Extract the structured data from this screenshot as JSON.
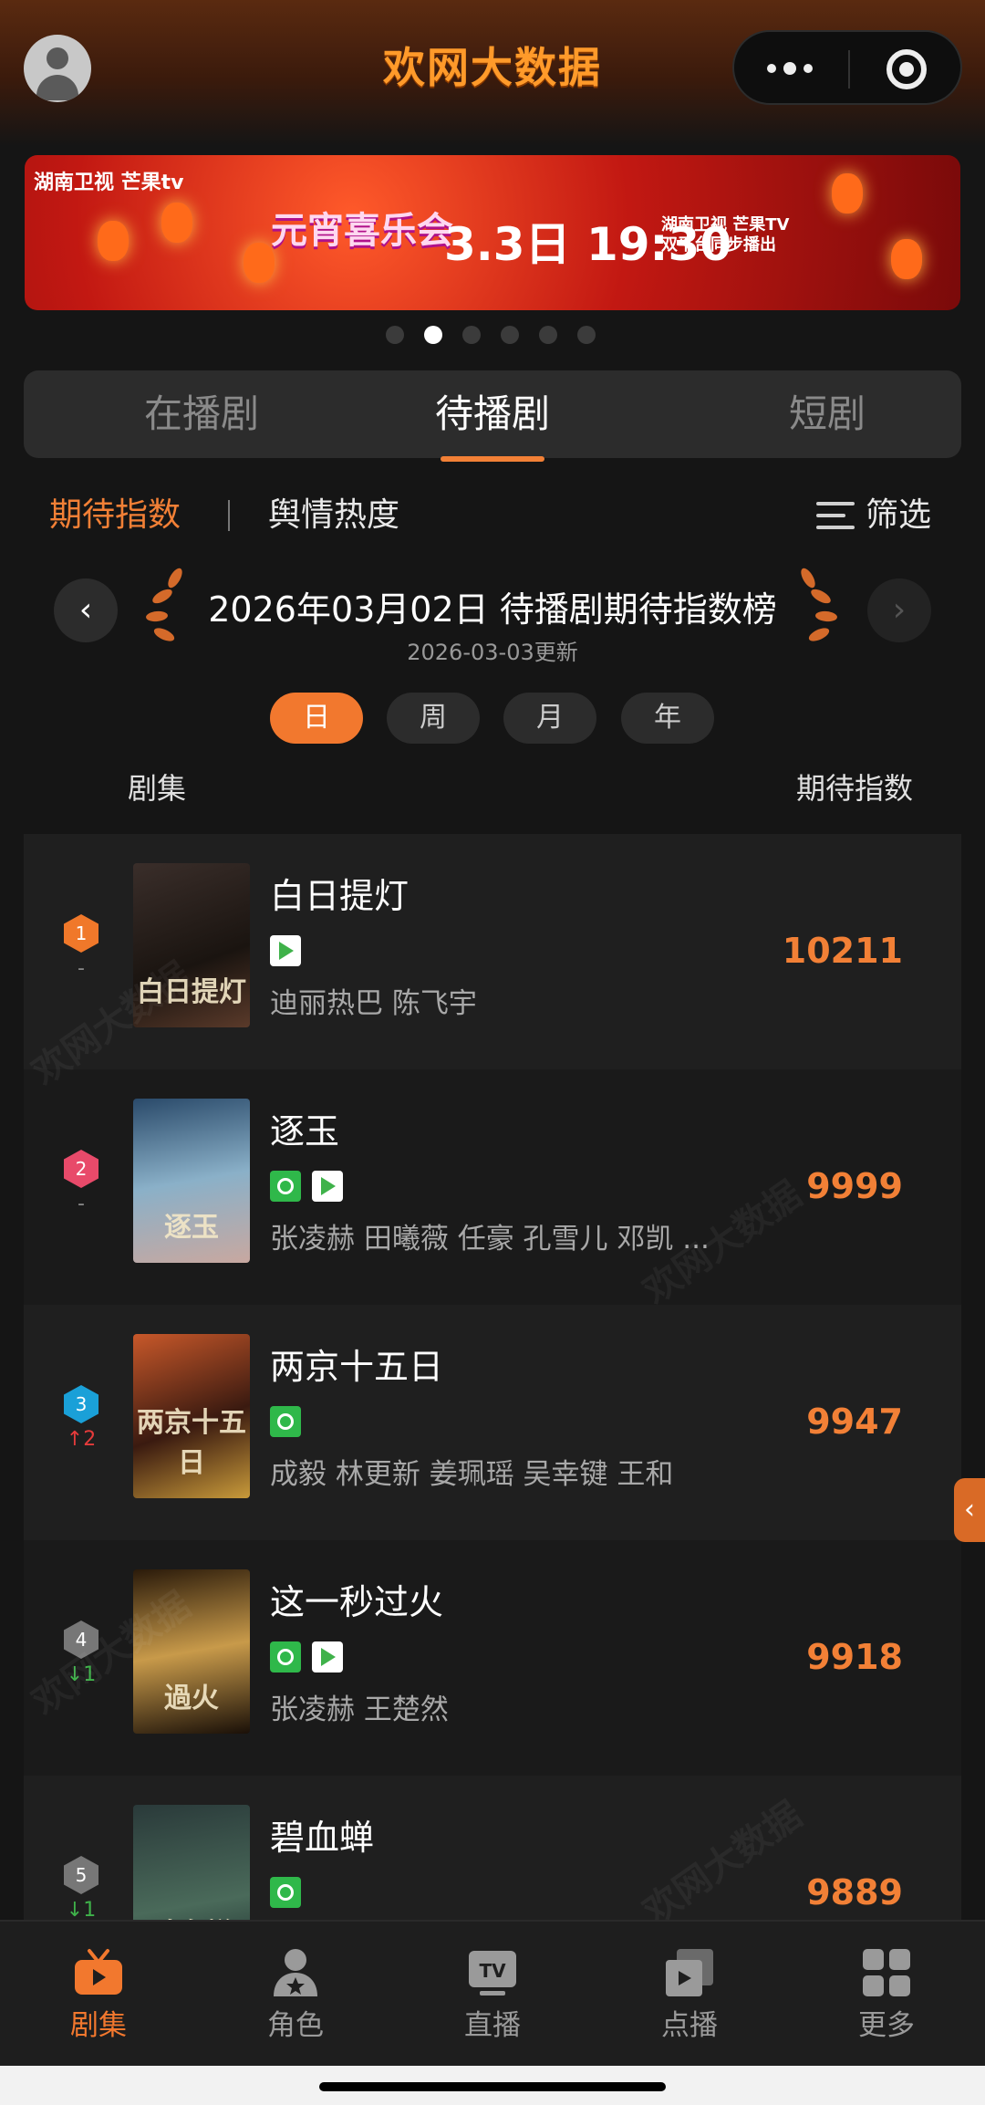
{
  "header": {
    "logo_text": "欢网大数据"
  },
  "banner": {
    "channels": "湖南卫视 芒果tv",
    "show": "元宵喜乐会",
    "date": "3.3日 19:30",
    "sub_line1": "湖南卫视 芒果TV",
    "sub_line2": "双平台同步播出"
  },
  "carousel": {
    "count": 6,
    "active_index": 1
  },
  "tabs": [
    {
      "label": "在播剧",
      "active": false
    },
    {
      "label": "待播剧",
      "active": true
    },
    {
      "label": "短剧",
      "active": false
    }
  ],
  "subtabs": {
    "expect": "期待指数",
    "sentiment": "舆情热度",
    "filter": "筛选"
  },
  "ranking": {
    "title": "2026年03月02日 待播剧期待指数榜",
    "updated": "2026-03-03更新",
    "prev_icon": "chevron-left-icon",
    "next_icon": "chevron-right-icon"
  },
  "periods": [
    {
      "label": "日",
      "active": true
    },
    {
      "label": "周",
      "active": false
    },
    {
      "label": "月",
      "active": false
    },
    {
      "label": "年",
      "active": false
    }
  ],
  "columns": {
    "left": "剧集",
    "right": "期待指数"
  },
  "shows": [
    {
      "rank": "1",
      "rank_color": "#f0782a",
      "trend": "-",
      "trend_dir": "none",
      "title": "白日提灯",
      "platforms": [
        "mgtv"
      ],
      "actors": "迪丽热巴 陈飞宇",
      "score": "10211",
      "poster": "白日提灯"
    },
    {
      "rank": "2",
      "rank_color": "#e84a6a",
      "trend": "-",
      "trend_dir": "none",
      "title": "逐玉",
      "platforms": [
        "iqiyi",
        "mgtv"
      ],
      "actors": "张凌赫 田曦薇 任豪 孔雪儿 邓凯 ...",
      "score": "9999",
      "poster": "逐玉"
    },
    {
      "rank": "3",
      "rank_color": "#1aa0d8",
      "trend": "↑2",
      "trend_dir": "up",
      "title": "两京十五日",
      "platforms": [
        "iqiyi"
      ],
      "actors": "成毅 林更新 姜珮瑶 吴幸键 王和",
      "score": "9947",
      "poster": "两京十五日"
    },
    {
      "rank": "4",
      "rank_color": "#777777",
      "trend": "↓1",
      "trend_dir": "down",
      "title": "这一秒过火",
      "platforms": [
        "iqiyi",
        "mgtv"
      ],
      "actors": "张凌赫 王楚然",
      "score": "9918",
      "poster": "過火"
    },
    {
      "rank": "5",
      "rank_color": "#777777",
      "trend": "↓1",
      "trend_dir": "down",
      "title": "碧血蝉",
      "platforms": [
        "iqiyi"
      ],
      "actors": "",
      "score": "9889",
      "poster": "碧血蝉"
    }
  ],
  "bottom_nav": [
    {
      "label": "剧集",
      "icon": "tv-icon",
      "active": true
    },
    {
      "label": "角色",
      "icon": "person-star-icon",
      "active": false
    },
    {
      "label": "直播",
      "icon": "live-tv-icon",
      "active": false
    },
    {
      "label": "点播",
      "icon": "vod-play-icon",
      "active": false
    },
    {
      "label": "更多",
      "icon": "grid-more-icon",
      "active": false
    }
  ],
  "watermark": "欢网大数据",
  "colors": {
    "accent": "#f28036",
    "background": "#151515",
    "row": "#1f1f1f"
  }
}
